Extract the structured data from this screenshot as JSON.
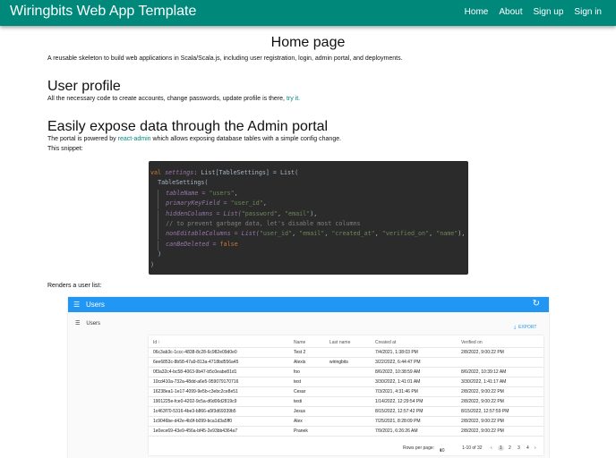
{
  "appbar": {
    "brand": "Wiringbits Web App Template",
    "nav": [
      "Home",
      "About",
      "Sign up",
      "Sign in"
    ]
  },
  "home": {
    "title": "Home page",
    "intro": "A reusable skeleton to build web applications in Scala/Scala.js, including user registration, login, admin portal, and deployments."
  },
  "profile": {
    "heading": "User profile",
    "text": "All the necessary code to create accounts, change passwords, update profile is there,",
    "link": "try it."
  },
  "admin": {
    "heading": "Easily expose data through the Admin portal",
    "text_before": "The portal is powered by",
    "link": "react-admin",
    "text_after": "which allows exposing database tables with a simple config change.",
    "snippet_label": "This snippet:",
    "renders_label": "Renders a user list:"
  },
  "code": {
    "l1_kw": "val",
    "l1_name": "settings",
    "l1_rest": ": List[TableSettings] = List(",
    "l2": "TableSettings(",
    "l3_a": "tableName = ",
    "l3_s": "\"users\"",
    "l4_a": "primaryKeyField = ",
    "l4_s": "\"user_id\"",
    "l5_a": "hiddenColumns = List(",
    "l5_s1": "\"password\"",
    "l5_s2": "\"email\"",
    "l6": "// to prevent garbage data, let's disable most columns",
    "l7_a": "nonEditableColumns = List(",
    "l7_s1": "\"user_id\"",
    "l7_s2": "\"email\"",
    "l7_s3": "\"created_at\"",
    "l7_s4": "\"verified_on\"",
    "l7_s5": "\"name\"",
    "l8_a": "canBeDeleted = ",
    "l8_kw": "false",
    "l9": ")",
    "l10": ")"
  },
  "userlist": {
    "bar_title": "Users",
    "side_item": "Users",
    "export": "EXPORT",
    "columns": [
      "Id ↑",
      "Name",
      "Last name",
      "Created at",
      "Verified on"
    ],
    "rows": [
      [
        "06c3ab3c-1ccc-4838-8c28-6c982e09d0e0",
        "Test 2",
        "",
        "7/4/2021, 1:38:03 PM",
        "2/8/2022, 9:00:22 PM"
      ],
      [
        "6ee6853c-8b58-47a9-813a-4718bd556a45",
        "Alexis",
        "wiringbits",
        "3/22/2022, 6:44:47 PM",
        ""
      ],
      [
        "0f3a32c4-bc58-4063-9b47-b5c0eabe81d1",
        "foo",
        "",
        "8/6/2022, 10:38:59 AM",
        "8/6/2022, 10:39:12 AM"
      ],
      [
        "10cd410a-732a-48dd-a6e5-959079170716",
        "test",
        "",
        "3/30/2022, 1:41:01 AM",
        "3/30/2022, 1:41:17 AM"
      ],
      [
        "16238ea1-1e17-4099-9e5b-c3ebc2ce8e51",
        "Cesar",
        "",
        "7/3/2021, 4:31:46 PM",
        "2/8/2022, 9:00:22 PM"
      ],
      [
        "1901225e-fce0-4202-9c5a-d6d06d2819c9",
        "testi",
        "",
        "1/14/2022, 12:29:54 PM",
        "2/8/2022, 9:00:22 PM"
      ],
      [
        "1c463f70-5316-4be3-b866-a5f3d69339b5",
        "Jesus",
        "",
        "8/15/2022, 12:57:42 PM",
        "8/15/2022, 12:57:59 PM"
      ],
      [
        "1c9046be-d42e-4b9f-b099-bca1d3a5ff0",
        "Alex",
        "",
        "7/25/2021, 8:28:09 PM",
        "2/8/2022, 9:00:22 PM"
      ],
      [
        "1e0ece69-43e9-456a-bf45-2e93bb4364a7",
        "Pranek",
        "",
        "7/9/2021, 6:26:26 AM",
        "2/8/2022, 9:00:22 PM"
      ]
    ],
    "rows_per_page_label": "Rows per page:",
    "rows_per_page": "10",
    "range": "1-10 of 32",
    "pages": [
      "1",
      "2",
      "3",
      "4"
    ]
  }
}
